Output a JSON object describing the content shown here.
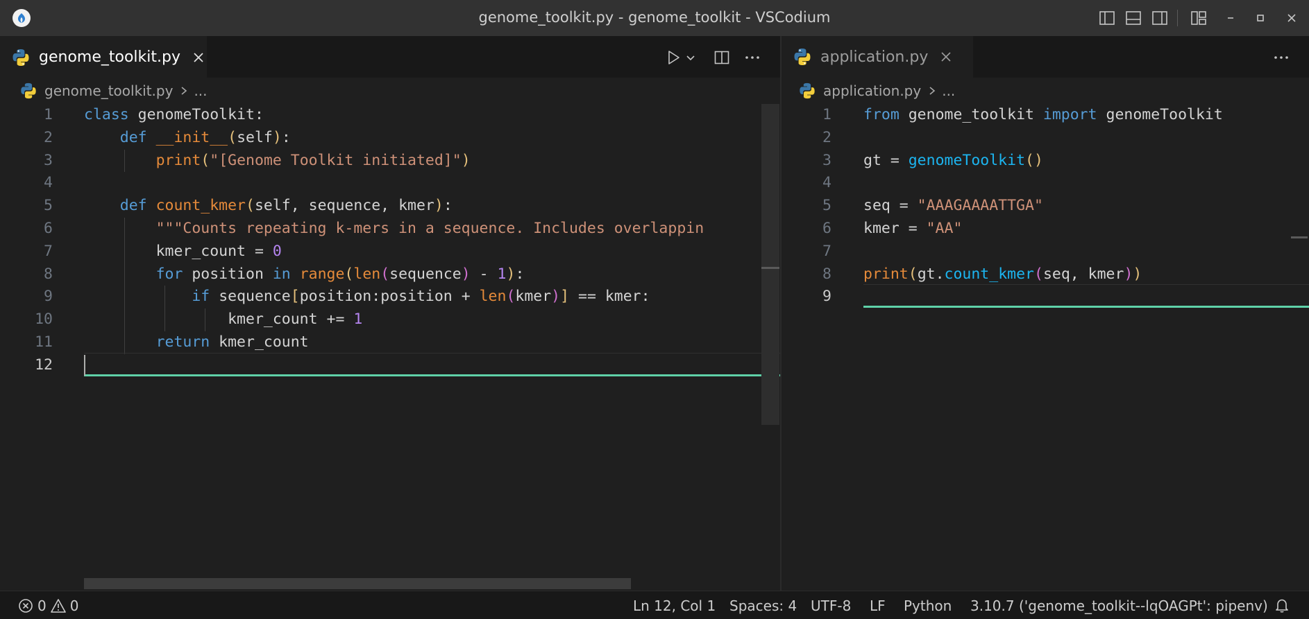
{
  "window": {
    "title": "genome_toolkit.py - genome_toolkit - VSCodium"
  },
  "icons": {
    "app": "vscodium-logo-icon",
    "layout": [
      "toggle-primary-sidebar-icon",
      "toggle-panel-icon",
      "toggle-secondary-sidebar-icon",
      "customize-layout-icon"
    ],
    "window_controls": [
      "minimize-icon",
      "maximize-icon",
      "close-icon"
    ]
  },
  "colors": {
    "keyword": "#569cd6",
    "function": "#e58a3a",
    "function_call": "#1cb5f0",
    "string": "#ce9178",
    "number": "#b585f0",
    "cursor_line_accent": "#5fd1a8"
  },
  "left_editor": {
    "tab_label": "genome_toolkit.py",
    "breadcrumb_file": "genome_toolkit.py",
    "breadcrumb_more": "...",
    "line_numbers": [
      "1",
      "2",
      "3",
      "4",
      "5",
      "6",
      "7",
      "8",
      "9",
      "10",
      "11",
      "12"
    ],
    "current_line": "12",
    "lines": [
      [
        {
          "t": "class ",
          "c": "kw"
        },
        {
          "t": "genomeToolkit:",
          "c": "plain"
        }
      ],
      [
        {
          "t": "    ",
          "c": "plain"
        },
        {
          "t": "def ",
          "c": "kw"
        },
        {
          "t": "__init__",
          "c": "fn"
        },
        {
          "t": "(",
          "c": "br1"
        },
        {
          "t": "self",
          "c": "plain"
        },
        {
          "t": ")",
          "c": "br1"
        },
        {
          "t": ":",
          "c": "plain"
        }
      ],
      [
        {
          "t": "        ",
          "c": "plain"
        },
        {
          "t": "print",
          "c": "fn"
        },
        {
          "t": "(",
          "c": "br1"
        },
        {
          "t": "\"[Genome Toolkit initiated]\"",
          "c": "str"
        },
        {
          "t": ")",
          "c": "br1"
        }
      ],
      [],
      [
        {
          "t": "    ",
          "c": "plain"
        },
        {
          "t": "def ",
          "c": "kw"
        },
        {
          "t": "count_kmer",
          "c": "fn"
        },
        {
          "t": "(",
          "c": "br1"
        },
        {
          "t": "self, sequence, kmer",
          "c": "plain"
        },
        {
          "t": ")",
          "c": "br1"
        },
        {
          "t": ":",
          "c": "plain"
        }
      ],
      [
        {
          "t": "        ",
          "c": "plain"
        },
        {
          "t": "\"\"\"Counts repeating k-mers in a sequence. Includes overlappin",
          "c": "str"
        }
      ],
      [
        {
          "t": "        ",
          "c": "plain"
        },
        {
          "t": "kmer_count = ",
          "c": "plain"
        },
        {
          "t": "0",
          "c": "num"
        }
      ],
      [
        {
          "t": "        ",
          "c": "plain"
        },
        {
          "t": "for ",
          "c": "ctl"
        },
        {
          "t": "position ",
          "c": "plain"
        },
        {
          "t": "in ",
          "c": "ctl"
        },
        {
          "t": "range",
          "c": "fn"
        },
        {
          "t": "(",
          "c": "br1"
        },
        {
          "t": "len",
          "c": "fn"
        },
        {
          "t": "(",
          "c": "br2"
        },
        {
          "t": "sequence",
          "c": "plain"
        },
        {
          "t": ")",
          "c": "br2"
        },
        {
          "t": " - ",
          "c": "plain"
        },
        {
          "t": "1",
          "c": "num"
        },
        {
          "t": ")",
          "c": "br1"
        },
        {
          "t": ":",
          "c": "plain"
        }
      ],
      [
        {
          "t": "            ",
          "c": "plain"
        },
        {
          "t": "if ",
          "c": "ctl"
        },
        {
          "t": "sequence",
          "c": "plain"
        },
        {
          "t": "[",
          "c": "br1"
        },
        {
          "t": "position:position + ",
          "c": "plain"
        },
        {
          "t": "len",
          "c": "fn"
        },
        {
          "t": "(",
          "c": "br2"
        },
        {
          "t": "kmer",
          "c": "plain"
        },
        {
          "t": ")",
          "c": "br2"
        },
        {
          "t": "]",
          "c": "br1"
        },
        {
          "t": " == kmer:",
          "c": "plain"
        }
      ],
      [
        {
          "t": "                ",
          "c": "plain"
        },
        {
          "t": "kmer_count += ",
          "c": "plain"
        },
        {
          "t": "1",
          "c": "num"
        }
      ],
      [
        {
          "t": "        ",
          "c": "plain"
        },
        {
          "t": "return ",
          "c": "ctl"
        },
        {
          "t": "kmer_count",
          "c": "plain"
        }
      ],
      []
    ]
  },
  "right_editor": {
    "tab_label": "application.py",
    "breadcrumb_file": "application.py",
    "breadcrumb_more": "...",
    "line_numbers": [
      "1",
      "2",
      "3",
      "4",
      "5",
      "6",
      "7",
      "8",
      "9"
    ],
    "current_line": "9",
    "lines": [
      [
        {
          "t": "from ",
          "c": "ctl"
        },
        {
          "t": "genome_toolkit ",
          "c": "plain"
        },
        {
          "t": "import ",
          "c": "ctl"
        },
        {
          "t": "genomeToolkit",
          "c": "plain"
        }
      ],
      [],
      [
        {
          "t": "gt = ",
          "c": "plain"
        },
        {
          "t": "genomeToolkit",
          "c": "fn2"
        },
        {
          "t": "()",
          "c": "br1"
        }
      ],
      [],
      [
        {
          "t": "seq = ",
          "c": "plain"
        },
        {
          "t": "\"AAAGAAAATTGA\"",
          "c": "str"
        }
      ],
      [
        {
          "t": "kmer = ",
          "c": "plain"
        },
        {
          "t": "\"AA\"",
          "c": "str"
        }
      ],
      [],
      [
        {
          "t": "print",
          "c": "fn"
        },
        {
          "t": "(",
          "c": "br1"
        },
        {
          "t": "gt.",
          "c": "plain"
        },
        {
          "t": "count_kmer",
          "c": "fn2"
        },
        {
          "t": "(",
          "c": "br2"
        },
        {
          "t": "seq, kmer",
          "c": "plain"
        },
        {
          "t": ")",
          "c": "br2"
        },
        {
          "t": ")",
          "c": "br1"
        }
      ],
      []
    ]
  },
  "statusbar": {
    "errors": "0",
    "warnings": "0",
    "position": "Ln 12, Col 1",
    "spaces": "Spaces: 4",
    "encoding": "UTF-8",
    "eol": "LF",
    "language": "Python",
    "interpreter": "3.10.7 ('genome_toolkit--lqOAGPt': pipenv)"
  }
}
